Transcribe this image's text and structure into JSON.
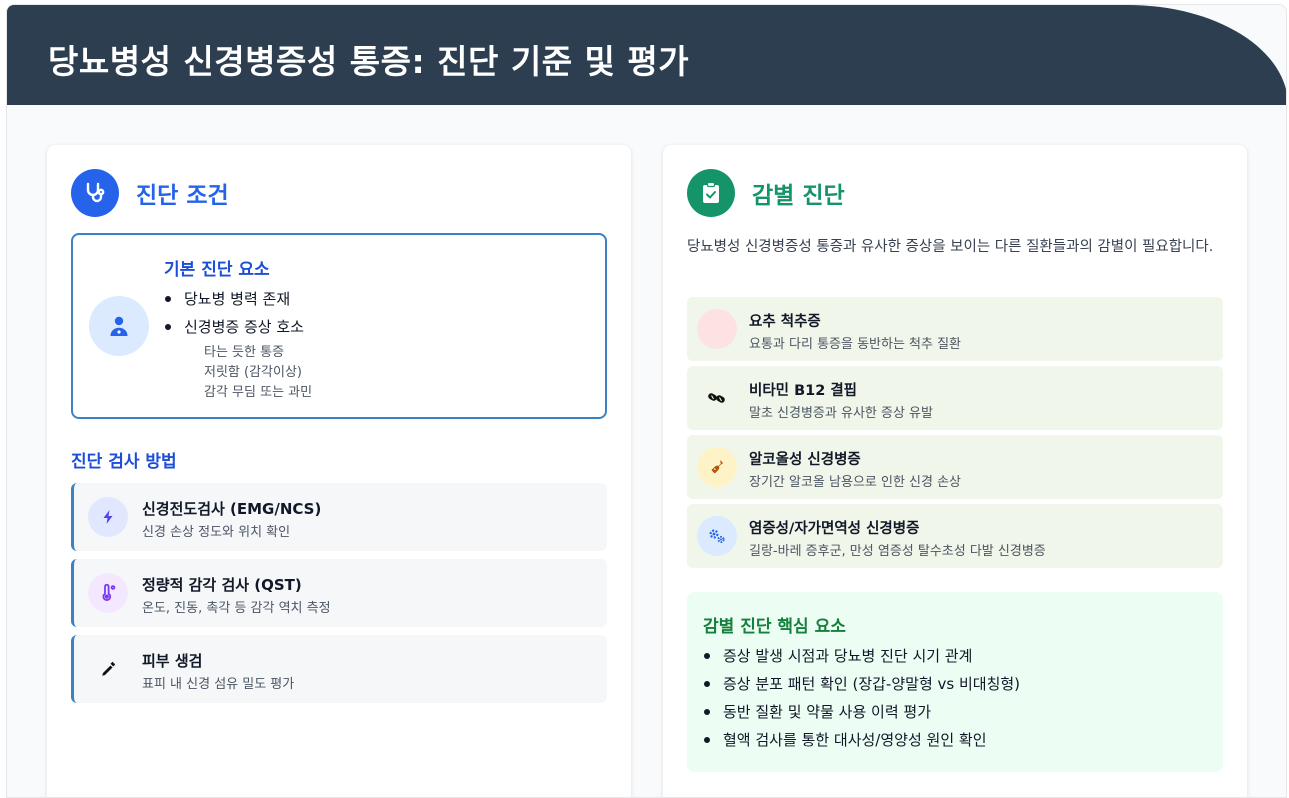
{
  "header": {
    "title": "당뇨병성 신경병증성 통증: 진단 기준 및 평가"
  },
  "diagnosis": {
    "title": "진단 조건",
    "icon": "stethoscope-icon",
    "criteria": {
      "title": "기본 진단 요소",
      "icon": "doctor-icon",
      "items": [
        "당뇨병 병력 존재",
        "신경병증 증상 호소"
      ],
      "symptoms": [
        "타는 듯한 통증",
        "저릿함 (감각이상)",
        "감각 무딤 또는 과민"
      ]
    },
    "methods": {
      "title": "진단 검사 방법",
      "items": [
        {
          "title": "신경전도검사 (EMG/NCS)",
          "desc": "신경 손상 정도와 위치 확인",
          "icon": "bolt-icon"
        },
        {
          "title": "정량적 감각 검사 (QST)",
          "desc": "온도, 진동, 촉각 등 감각 역치 측정",
          "icon": "thermometer-icon"
        },
        {
          "title": "피부 생검",
          "desc": "표피 내 신경 섬유 밀도 평가",
          "icon": "eyedropper-icon"
        }
      ]
    }
  },
  "differential": {
    "title": "감별 진단",
    "icon": "clipboard-check-icon",
    "intro": "당뇨병성 신경병증성 통증과 유사한 증상을 보이는 다른 질환들과의 감별이 필요합니다.",
    "items": [
      {
        "title": "요추 척추증",
        "desc": "요통과 다리 통증을 동반하는 척추 질환",
        "icon": "spine-icon"
      },
      {
        "title": "비타민 B12 결핍",
        "desc": "말초 신경병증과 유사한 증상 유발",
        "icon": "pills-icon"
      },
      {
        "title": "알코올성 신경병증",
        "desc": "장기간 알코올 남용으로 인한 신경 손상",
        "icon": "bottle-icon"
      },
      {
        "title": "염증성/자가면역성 신경병증",
        "desc": "길랑-바레 증후군, 만성 염증성 탈수초성 다발 신경병증",
        "icon": "gears-icon"
      }
    ],
    "key": {
      "title": "감별 진단 핵심 요소",
      "items": [
        "증상 발생 시점과 당뇨병 진단 시기 관계",
        "증상 분포 패턴 확인 (장갑-양말형 vs 비대칭형)",
        "동반 질환 및 약물 사용 이력 평가",
        "혈액 검사를 통한 대사성/영양성 원인 확인"
      ]
    }
  },
  "colors": {
    "header_bg": "#2d3e50",
    "blue_accent": "#2563eb",
    "green_accent": "#15946a",
    "ddx_item_bg": "#f0f6e9",
    "key_box_bg": "#ecfdf3"
  }
}
